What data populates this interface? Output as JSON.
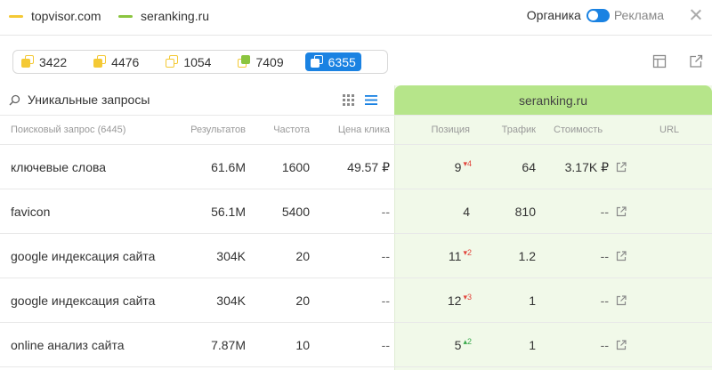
{
  "header": {
    "domains": [
      {
        "label": "topvisor.com",
        "color": "#f4c935"
      },
      {
        "label": "seranking.ru",
        "color": "#8bc53f"
      }
    ],
    "toggle": {
      "left_label": "Органика",
      "right_label": "Реклама",
      "color": "#1a82e2"
    }
  },
  "counters": [
    {
      "value": "3422",
      "icon": "both-domains-icon",
      "colors": [
        "#f4c935",
        "#f4c935"
      ]
    },
    {
      "value": "4476",
      "icon": "both-domains-icon",
      "colors": [
        "#f4c935",
        "#f4c935"
      ]
    },
    {
      "value": "1054",
      "icon": "first-only-icon",
      "colors": [
        "#f4c935",
        "#f4c935"
      ]
    },
    {
      "value": "7409",
      "icon": "second-only-icon",
      "colors": [
        "#f4c935",
        "#8bc53f"
      ]
    },
    {
      "value": "6355",
      "icon": "active-set-icon",
      "colors": [
        "#ffffff",
        "#ffffff"
      ],
      "active": true,
      "active_color": "#1a82e2"
    }
  ],
  "search": {
    "label": "Уникальные запросы"
  },
  "panel": {
    "title": "seranking.ru",
    "header_color": "#b6e58a"
  },
  "columns": {
    "query": "Поисковый запрос (6445)",
    "results": "Результатов",
    "frequency": "Частота",
    "cpc": "Цена клика",
    "position": "Позиция",
    "traffic": "Трафик",
    "cost": "Стоимость",
    "url": "URL"
  },
  "rows": [
    {
      "query": "ключевые слова",
      "results": "61.6M",
      "frequency": "1600",
      "cpc": "49.57 ₽",
      "position": "9",
      "delta": "▾4",
      "delta_dir": "down",
      "traffic": "64",
      "cost": "3.17K ₽"
    },
    {
      "query": "favicon",
      "results": "56.1M",
      "frequency": "5400",
      "cpc": "--",
      "position": "4",
      "delta": "",
      "delta_dir": "",
      "traffic": "810",
      "cost": "--"
    },
    {
      "query": "google индексация сайта",
      "results": "304K",
      "frequency": "20",
      "cpc": "--",
      "position": "11",
      "delta": "▾2",
      "delta_dir": "down",
      "traffic": "1.2",
      "cost": "--"
    },
    {
      "query": "google индексация сайта",
      "results": "304K",
      "frequency": "20",
      "cpc": "--",
      "position": "12",
      "delta": "▾3",
      "delta_dir": "down",
      "traffic": "1",
      "cost": "--"
    },
    {
      "query": "online анализ сайта",
      "results": "7.87M",
      "frequency": "10",
      "cpc": "--",
      "position": "5",
      "delta": "▴2",
      "delta_dir": "up",
      "traffic": "1",
      "cost": "--"
    }
  ],
  "colors": {
    "delta_down": "#e2453c",
    "delta_up": "#38a84a",
    "icon_gray": "#8a8a8a",
    "list_active": "#1a82e2"
  }
}
